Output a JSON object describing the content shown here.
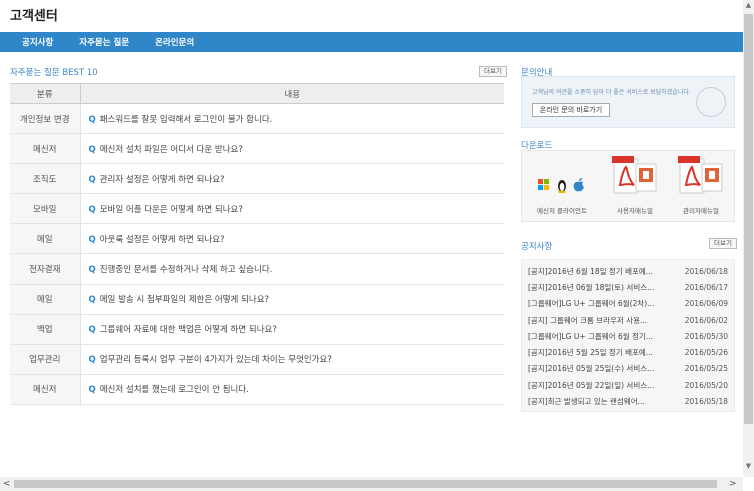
{
  "page": {
    "title": "고객센터"
  },
  "nav": {
    "items": [
      "공지사항",
      "자주묻는 질문",
      "온라인문의"
    ]
  },
  "faq": {
    "title": "자주묻는 질문 BEST 10",
    "more_label": "더보기",
    "headers": {
      "category": "분류",
      "content": "내용"
    },
    "q_marker": "Q",
    "rows": [
      {
        "category": "개인정보 변경",
        "question": "패스워드를 잘못 입력해서 로그인이 불가 합니다."
      },
      {
        "category": "메신저",
        "question": "메신저 설치 파일은 어디서 다운 받나요?"
      },
      {
        "category": "조직도",
        "question": "관리자 설정은 어떻게 하면 되나요?"
      },
      {
        "category": "모바일",
        "question": "모바일 어플 다운은 어떻게 하면 되나요?"
      },
      {
        "category": "메일",
        "question": "아웃룩 설정은 어떻게 하면 되나요?"
      },
      {
        "category": "전자결재",
        "question": "진행중인 문서를 수정하거나 삭제 하고 싶습니다."
      },
      {
        "category": "메일",
        "question": "메일 발송 시 첨부파일의 제한은 어떻게 되나요?"
      },
      {
        "category": "백업",
        "question": "그룹웨어 자료에 대한 백업은 어떻게 하면 되나요?"
      },
      {
        "category": "업무관리",
        "question": "업무관리 등록시 업무 구분이 4가지가 있는데 차이는 무엇인가요?"
      },
      {
        "category": "메신저",
        "question": "메신저 설치를 했는데 로그인이 안 됩니다."
      }
    ]
  },
  "inquiry": {
    "title": "문의안내",
    "text": "고객님의 의견을 소중히 담아 더 좋은 서비스로 보답하겠습니다.",
    "button_label": "온라인 문의 바로가기"
  },
  "download": {
    "title": "다운로드",
    "items": [
      {
        "label": "메신저 클라이언트",
        "icons": [
          "windows-icon",
          "linux-icon",
          "apple-icon"
        ]
      },
      {
        "label": "사용자매뉴얼",
        "icons": [
          "pdf-icon",
          "ppt-icon"
        ]
      },
      {
        "label": "관리자매뉴얼",
        "icons": [
          "pdf-icon",
          "ppt-icon"
        ]
      }
    ]
  },
  "notice": {
    "title": "공지사항",
    "more_label": "더보기",
    "rows": [
      {
        "title": "[공지]2016년 6월 18일 정기 배포예...",
        "date": "2016/06/18"
      },
      {
        "title": "[공지]2016년 06월 18일(토) 서비스...",
        "date": "2016/06/17"
      },
      {
        "title": "[그룹웨어]LG U+ 그룹웨어 6월(2차)...",
        "date": "2016/06/09"
      },
      {
        "title": "[공지] 그룹웨어 크롬 브라우저 사용...",
        "date": "2016/06/02"
      },
      {
        "title": "[그룹웨어]LG U+ 그룹웨어 6월 정기...",
        "date": "2016/05/30"
      },
      {
        "title": "[공지]2016년 5월 25일 정기 배포예...",
        "date": "2016/05/26"
      },
      {
        "title": "[공지]2016년 05월 25일(수) 서비스...",
        "date": "2016/05/25"
      },
      {
        "title": "[공지]2016년 05월 22일(일) 서비스...",
        "date": "2016/05/20"
      },
      {
        "title": "[공지]최근 발생되고 있는 랜섬웨어...",
        "date": "2016/05/18"
      }
    ]
  },
  "colors": {
    "accent": "#2f86c8",
    "section_title": "#3a87c8",
    "pdf_red": "#d9332b",
    "ppt_orange": "#e0643a"
  }
}
